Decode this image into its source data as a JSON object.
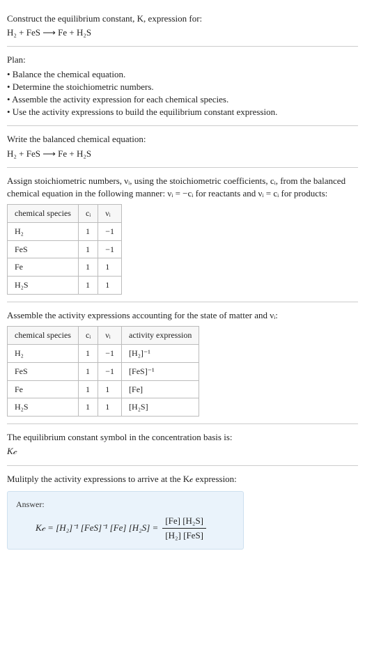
{
  "top": {
    "title": "Construct the equilibrium constant, K, expression for:",
    "equation": "H₂ + FeS ⟶ Fe + H₂S"
  },
  "plan": {
    "title": "Plan:",
    "items": [
      "• Balance the chemical equation.",
      "• Determine the stoichiometric numbers.",
      "• Assemble the activity expression for each chemical species.",
      "• Use the activity expressions to build the equilibrium constant expression."
    ]
  },
  "balanced": {
    "title": "Write the balanced chemical equation:",
    "equation": "H₂ + FeS ⟶ Fe + H₂S"
  },
  "stoich": {
    "title": "Assign stoichiometric numbers, νᵢ, using the stoichiometric coefficients, cᵢ, from the balanced chemical equation in the following manner: νᵢ = −cᵢ for reactants and νᵢ = cᵢ for products:",
    "headers": {
      "species": "chemical species",
      "ci": "cᵢ",
      "vi": "νᵢ"
    },
    "rows": [
      {
        "species": "H₂",
        "ci": "1",
        "vi": "−1"
      },
      {
        "species": "FeS",
        "ci": "1",
        "vi": "−1"
      },
      {
        "species": "Fe",
        "ci": "1",
        "vi": "1"
      },
      {
        "species": "H₂S",
        "ci": "1",
        "vi": "1"
      }
    ]
  },
  "activity": {
    "title": "Assemble the activity expressions accounting for the state of matter and νᵢ:",
    "headers": {
      "species": "chemical species",
      "ci": "cᵢ",
      "vi": "νᵢ",
      "expr": "activity expression"
    },
    "rows": [
      {
        "species": "H₂",
        "ci": "1",
        "vi": "−1",
        "expr": "[H₂]⁻¹"
      },
      {
        "species": "FeS",
        "ci": "1",
        "vi": "−1",
        "expr": "[FeS]⁻¹"
      },
      {
        "species": "Fe",
        "ci": "1",
        "vi": "1",
        "expr": "[Fe]"
      },
      {
        "species": "H₂S",
        "ci": "1",
        "vi": "1",
        "expr": "[H₂S]"
      }
    ]
  },
  "kc": {
    "title": "The equilibrium constant symbol in the concentration basis is:",
    "symbol": "K𝒸"
  },
  "multiply": {
    "title": "Mulitply the activity expressions to arrive at the K𝒸 expression:"
  },
  "answer": {
    "label": "Answer:",
    "lhs": "K𝒸 = [H₂]⁻¹ [FeS]⁻¹ [Fe] [H₂S] =",
    "frac_num": "[Fe] [H₂S]",
    "frac_den": "[H₂] [FeS]"
  }
}
